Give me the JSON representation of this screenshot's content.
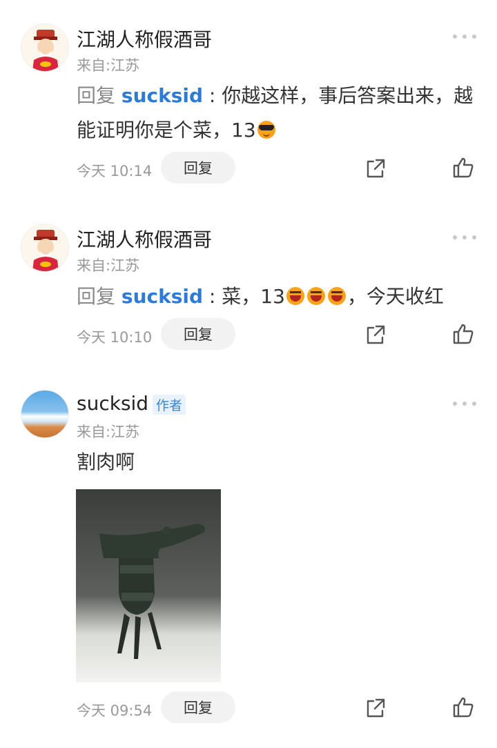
{
  "comments": [
    {
      "username": "江湖人称假酒哥",
      "location": "来自:江苏",
      "reply_prefix": "回复 ",
      "reply_to": "sucksid",
      "separator": " : ",
      "text": "你越这样，事后答案出来，越能证明你是个菜，13",
      "emojis": [
        "cool-emoji"
      ],
      "time": "今天 10:14",
      "reply_button": "回复",
      "avatar": "fortune-god-avatar"
    },
    {
      "username": "江湖人称假酒哥",
      "location": "来自:江苏",
      "reply_prefix": "回复 ",
      "reply_to": "sucksid",
      "separator": " : ",
      "text_before": "菜，13",
      "emojis": [
        "laugh-emoji",
        "laugh-emoji",
        "laugh-emoji"
      ],
      "text_after": "，今天收红",
      "time": "今天 10:10",
      "reply_button": "回复",
      "avatar": "fortune-god-avatar"
    },
    {
      "username": "sucksid",
      "author_badge": "作者",
      "location": "来自:江苏",
      "text": "割肉啊",
      "image": "bronze-jue-vessel-photo",
      "time": "今天 09:54",
      "reply_button": "回复",
      "avatar": "sky-sea-avatar"
    }
  ],
  "icons": {
    "more": "more-dots-icon",
    "share": "share-icon",
    "like": "thumbs-up-icon"
  },
  "colors": {
    "link_blue": "#2e7bd6",
    "meta_gray": "#999999",
    "button_bg": "#f2f2f2"
  }
}
